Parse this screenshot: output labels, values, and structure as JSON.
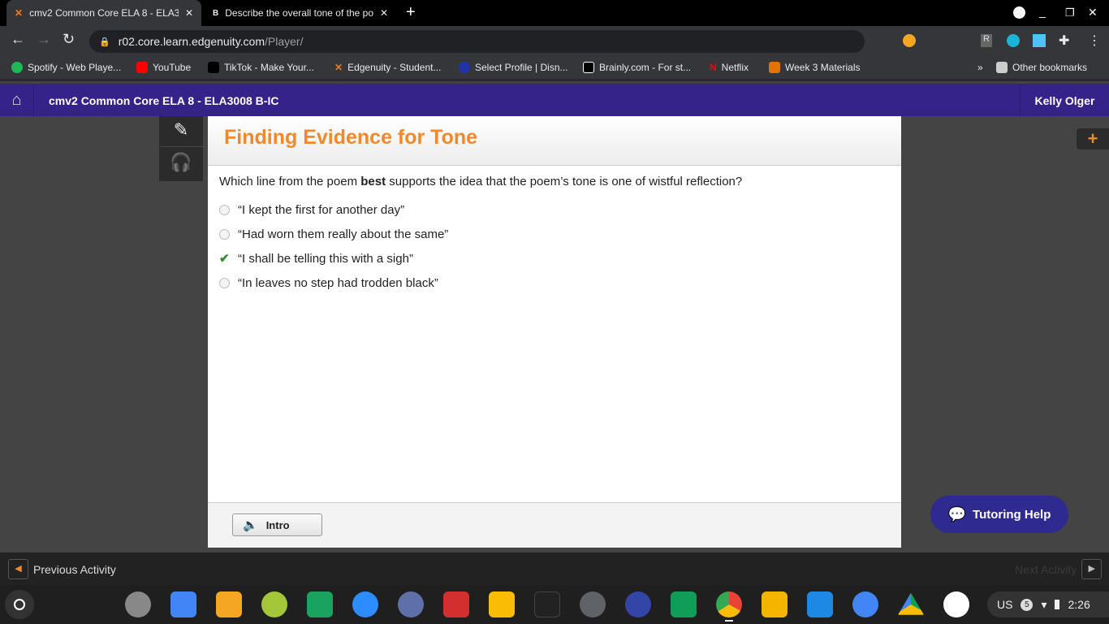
{
  "browser": {
    "tabs": [
      {
        "title": "cmv2 Common Core ELA 8 - ELA3008 B-IC",
        "active": true
      },
      {
        "title": "Describe the overall tone of the poem",
        "active": false
      }
    ],
    "url_host": "r02.core.learn.edgenuity.com",
    "url_path": "/Player/",
    "bookmarks": [
      "Spotify - Web Playe...",
      "YouTube",
      "TikTok - Make Your...",
      "Edgenuity - Student...",
      "Select Profile | Disn...",
      "Brainly.com - For st...",
      "Netflix",
      "Week 3 Materials"
    ],
    "other_bookmarks": "Other bookmarks",
    "ext_r": "R"
  },
  "header": {
    "course": "cmv2 Common Core ELA 8 - ELA3008 B-IC",
    "user": "Kelly Olger"
  },
  "activity": {
    "title": "Finding Evidence for Tone",
    "question_pre": "Which line from the poem ",
    "question_bold": "best",
    "question_post": " supports the idea that the poem’s tone is one of wistful reflection?",
    "answers": [
      {
        "text": "“I kept the first for another day”",
        "correct": false
      },
      {
        "text": "“Had worn them really about the same”",
        "correct": false
      },
      {
        "text": "“I shall be telling this with a sigh”",
        "correct": true
      },
      {
        "text": "“In leaves no step had trodden black”",
        "correct": false
      }
    ],
    "intro_label": "Intro"
  },
  "nav": {
    "previous": "Previous Activity",
    "next": "Next Activity"
  },
  "tutoring": "Tutoring Help",
  "colors": {
    "title": "#f0892b",
    "header": "#35238a",
    "tutor": "#2f2a8f",
    "check": "#2e8b2e"
  },
  "tray": {
    "lang": "US",
    "notifications": "5",
    "time": "2:26"
  }
}
